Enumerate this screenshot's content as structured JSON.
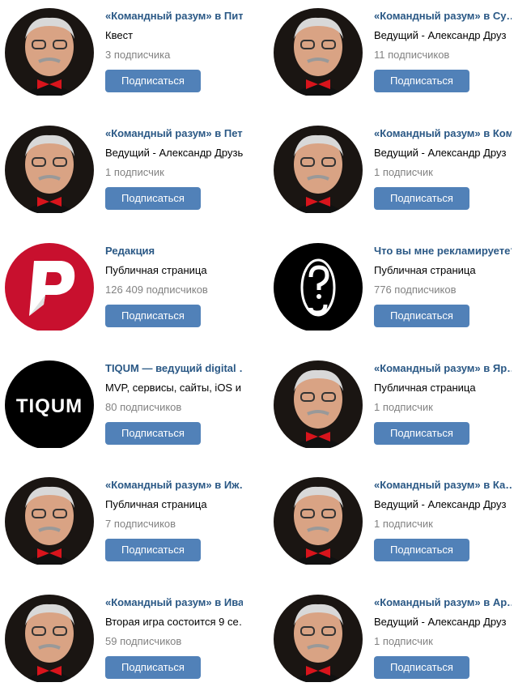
{
  "communities": [
    {
      "title": "«Командный разум» в Пит…",
      "description": "Квест",
      "subscribers": "3 подписчика",
      "avatar": "host-photo"
    },
    {
      "title": "«Командный разум» в Сур…",
      "description": "Ведущий - Александр Друз",
      "subscribers": "11 подписчиков",
      "avatar": "host-photo"
    },
    {
      "title": "«Командный разум» в Пет…",
      "description": "Ведущий - Александр Друзь",
      "subscribers": "1 подписчик",
      "avatar": "host-photo"
    },
    {
      "title": "«Командный разум» в Ком",
      "description": "Ведущий - Александр Друз",
      "subscribers": "1 подписчик",
      "avatar": "host-photo"
    },
    {
      "title": "Редакция",
      "description": "Публичная страница",
      "subscribers": "126 409 подписчиков",
      "avatar": "redaktsiya-logo"
    },
    {
      "title": "Что вы мне рекламируете?",
      "description": "Публичная страница",
      "subscribers": "776 подписчиков",
      "avatar": "question-mark-logo"
    },
    {
      "title": "TIQUM — ведущий digital и…",
      "description": "MVP, сервисы, сайты, iOS и …",
      "subscribers": "80 подписчиков",
      "avatar": "tiqum-logo",
      "logo_text": "TIQUM"
    },
    {
      "title": "«Командный разум» в Яро…",
      "description": "Публичная страница",
      "subscribers": "1 подписчик",
      "avatar": "host-photo"
    },
    {
      "title": "«Командный разум» в Иж…",
      "description": "Публичная страница",
      "subscribers": "7 подписчиков",
      "avatar": "host-photo"
    },
    {
      "title": "«Командный разум» в Кал…",
      "description": "Ведущий - Александр Друз",
      "subscribers": "1 подписчик",
      "avatar": "host-photo"
    },
    {
      "title": "«Командный разум» в Ива…",
      "description": "Вторая игра состоится 9 се…",
      "subscribers": "59 подписчиков",
      "avatar": "host-photo"
    },
    {
      "title": "«Командный разум» в Арх…",
      "description": "Ведущий - Александр Друз",
      "subscribers": "1 подписчик",
      "avatar": "host-photo"
    }
  ],
  "subscribe_label": "Подписаться",
  "colors": {
    "title": "#2a5885",
    "button": "#5181b8",
    "subs": "#828282",
    "redaktsiya": "#c8102e"
  }
}
